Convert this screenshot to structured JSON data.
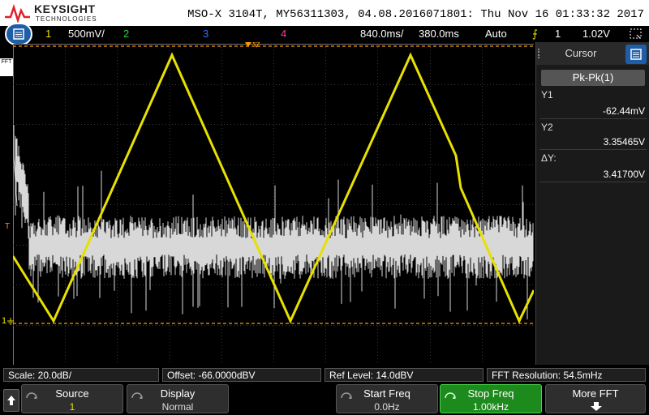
{
  "header": {
    "brand_name": "KEYSIGHT",
    "brand_sub": "TECHNOLOGIES",
    "title": "MSO-X 3104T, MY56311303, 04.08.2016071801: Thu Nov 16 01:33:32 2017"
  },
  "channel_bar": {
    "ch1_number": "1",
    "ch1_scale": "500mV/",
    "ch2_number": "2",
    "ch3_number": "3",
    "ch4_number": "4",
    "timebase_delay": "840.0ms/",
    "timebase_position": "380.0ms",
    "trigger_mode": "Auto",
    "trigger_source": "1",
    "trigger_level": "1.02V"
  },
  "markers": {
    "fft_label": "FFT",
    "trigger_marker": "T",
    "ground_marker": "1"
  },
  "cursor_panel": {
    "tab_label": "Cursor",
    "mode": "Pk-Pk(1)",
    "y1_label": "Y1",
    "y1_value": "-62.44mV",
    "y2_label": "Y2",
    "y2_value": "3.35465V",
    "dy_label": "ΔY:",
    "dy_value": "3.41700V"
  },
  "status_bar": {
    "scale": "Scale: 20.0dB/",
    "offset": "Offset: -66.0000dBV",
    "ref_level": "Ref Level: 14.0dBV",
    "fft_resolution": "FFT Resolution: 54.5mHz"
  },
  "softkeys": {
    "source_label": "Source",
    "source_value": "1",
    "display_label": "Display",
    "display_value": "Normal",
    "start_freq_label": "Start Freq",
    "start_freq_value": "0.0Hz",
    "stop_freq_label": "Stop Freq",
    "stop_freq_value": "1.00kHz",
    "more_fft_label": "More FFT"
  },
  "colors": {
    "ch1": "#e8e000",
    "ch2": "#2ecc40",
    "ch3": "#3a6dff",
    "ch4": "#ff3a9e",
    "fft": "#d8d8d8",
    "cursor": "#ff9900",
    "accent": "#1e5ea8"
  }
}
